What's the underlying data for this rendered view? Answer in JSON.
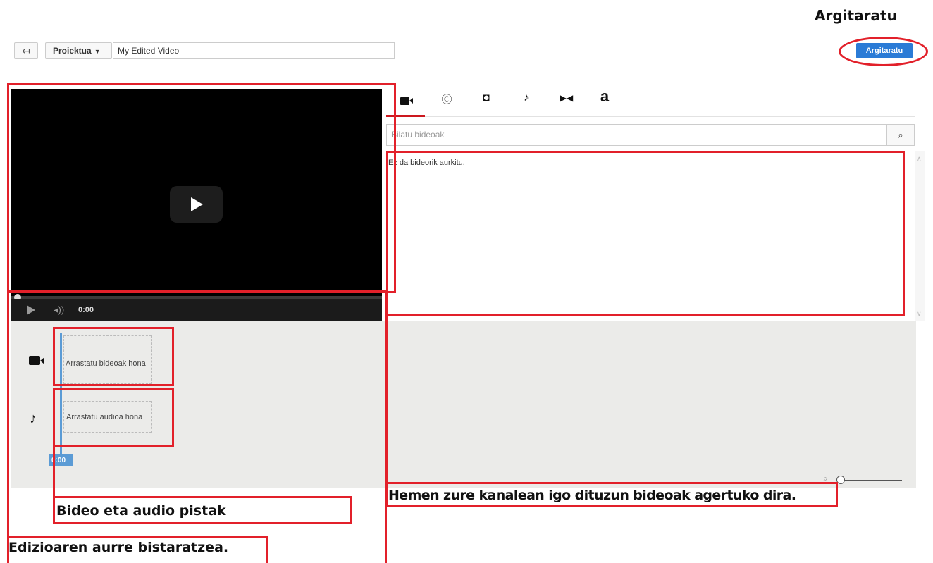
{
  "annotations": {
    "top_publish": "Argitaratu",
    "tracks": "Bideo eta audio pistak",
    "preview": "Edizioaren aurre bistaratzea.",
    "channel_videos": "Hemen zure kanalean igo dituzun bideoak agertuko dira."
  },
  "toolbar": {
    "back_icon": "↤",
    "project_label": "Proiektua",
    "project_caret": "▼",
    "title_value": "My Edited Video",
    "publish_label": "Argitaratu"
  },
  "player": {
    "time": "0:00",
    "volume_icon": "◂))"
  },
  "timeline": {
    "video_drop_label": "Arrastatu bideoak hona",
    "audio_drop_label": "Arrastatu audioa hona",
    "playhead_time": "0:00",
    "note_icon": "♪"
  },
  "right_panel": {
    "tabs": [
      {
        "name": "video-camera-icon",
        "glyph": ""
      },
      {
        "name": "creative-commons-icon",
        "glyph": "Ⓒ"
      },
      {
        "name": "photo-camera-icon",
        "glyph": "◘"
      },
      {
        "name": "music-note-icon",
        "glyph": "♪"
      },
      {
        "name": "transitions-icon",
        "glyph": "▶◀"
      },
      {
        "name": "text-icon",
        "glyph": "a"
      }
    ],
    "search_placeholder": "Bilatu bideoak",
    "search_icon": "⌕",
    "results_text": "Ez da bideorik aurkitu.",
    "scroll_up": "∧",
    "scroll_down": "∨",
    "zoom_icon": "⌕"
  },
  "colors": {
    "annotation_red": "#e2202a",
    "publish_blue": "#2b7bd6",
    "playhead_blue": "#5b9bd5",
    "active_tab_red": "#cc181e"
  }
}
